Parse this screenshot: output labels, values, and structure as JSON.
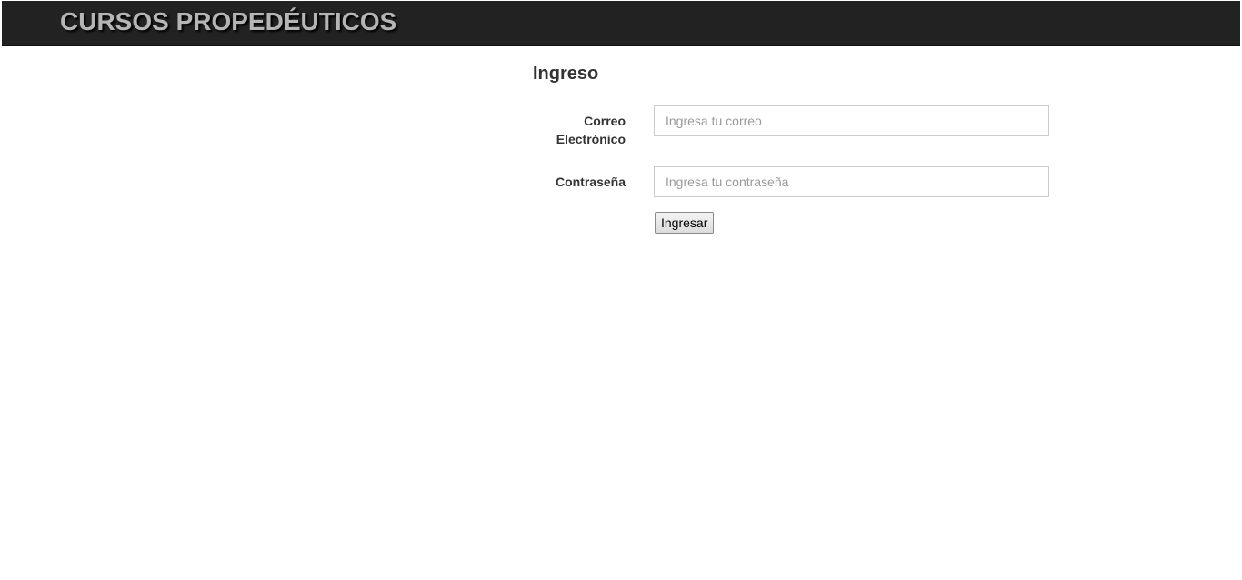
{
  "header": {
    "brand_title": "CURSOS PROPEDÉUTICOS"
  },
  "login": {
    "title": "Ingreso",
    "email": {
      "label_line1": "Correo",
      "label_line2": "Electrónico",
      "placeholder": "Ingresa tu correo",
      "value": ""
    },
    "password": {
      "label": "Contraseña",
      "placeholder": "Ingresa tu contraseña",
      "value": ""
    },
    "submit_label": "Ingresar"
  }
}
